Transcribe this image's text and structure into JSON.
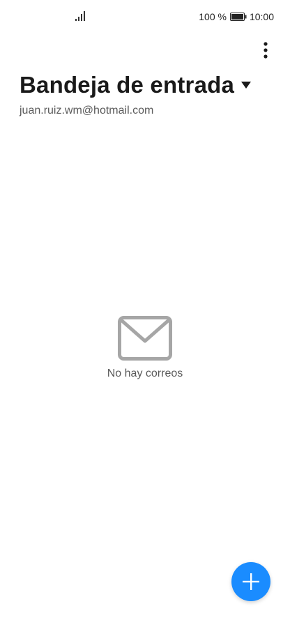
{
  "status_bar": {
    "battery_text": "100 %",
    "time": "10:00"
  },
  "header": {
    "title": "Bandeja de entrada",
    "account_email": "juan.ruiz.wm@hotmail.com"
  },
  "empty_state": {
    "message": "No hay correos",
    "icon": "mail-icon"
  },
  "actions": {
    "overflow_icon": "more-vertical-icon",
    "compose_icon": "plus-icon"
  },
  "colors": {
    "accent": "#1a8cff",
    "icon_gray": "#a6a6a6",
    "text_primary": "#1a1a1a",
    "text_secondary": "#5a5a5a"
  }
}
